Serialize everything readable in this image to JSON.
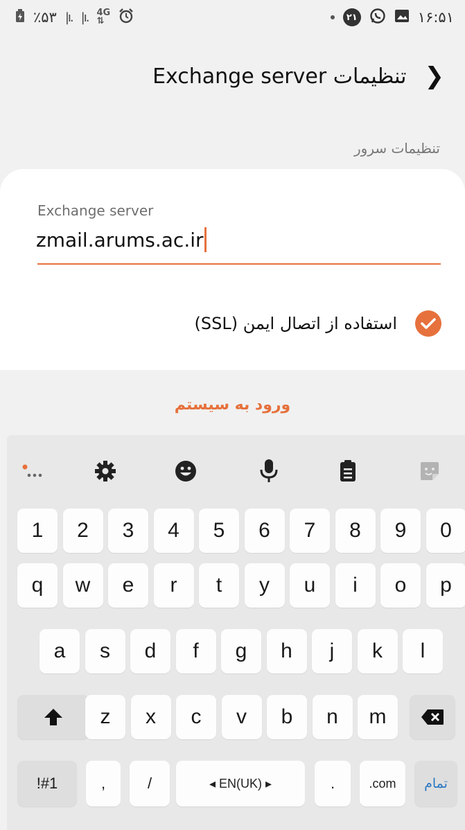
{
  "status_bar": {
    "battery": "٪۵۳",
    "network": "4G",
    "notification_badge": "۲۱",
    "time": "۱۶:۵۱"
  },
  "header": {
    "title": "تنظیمات Exchange server"
  },
  "section": {
    "title": "تنظیمات سرور"
  },
  "server_field": {
    "label": "Exchange server",
    "value": "zmail.arums.ac.ir"
  },
  "ssl_option": {
    "label": "استفاده از اتصال ایمن (SSL)",
    "checked": true
  },
  "login_button": {
    "label": "ورود به سیستم"
  },
  "keyboard": {
    "toolbar": [
      "more-icon",
      "gear-icon",
      "emoji-icon",
      "microphone-icon",
      "clipboard-icon",
      "sticker-icon"
    ],
    "row_numbers": [
      "1",
      "2",
      "3",
      "4",
      "5",
      "6",
      "7",
      "8",
      "9",
      "0"
    ],
    "row_top": [
      "q",
      "w",
      "e",
      "r",
      "t",
      "y",
      "u",
      "i",
      "o",
      "p"
    ],
    "row_home": [
      "a",
      "s",
      "d",
      "f",
      "g",
      "h",
      "j",
      "k",
      "l"
    ],
    "row_bottom": [
      "z",
      "x",
      "c",
      "v",
      "b",
      "n",
      "m"
    ],
    "symbols_key": "!#1",
    "comma_key": ",",
    "slash_key": "/",
    "language_key": "◂ EN(UK) ▸",
    "period_key": ".",
    "dotcom_key": ".com",
    "done_key": "تمام"
  },
  "colors": {
    "accent": "#e6713c",
    "background": "#f1f1f1",
    "keyboard_background": "#e8e8e8",
    "key_background": "#fdfdfd",
    "done_text": "#2a78c2"
  }
}
